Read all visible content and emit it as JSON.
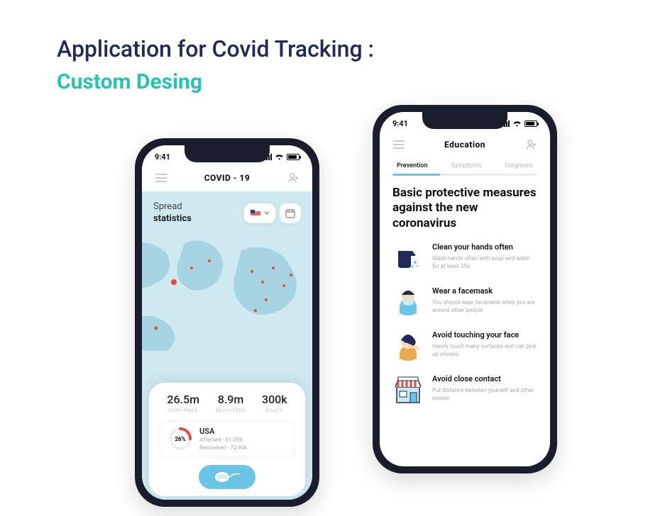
{
  "heading": {
    "title": "Application for Covid Tracking :",
    "subtitle": "Custom Desing"
  },
  "statusbar": {
    "time": "9:41"
  },
  "phoneLeft": {
    "appbar": {
      "title": "COVID - 19"
    },
    "spread": {
      "label1": "Spread",
      "label2": "statistics"
    },
    "stats": [
      {
        "value": "26.5m",
        "label": "CONFIRMED"
      },
      {
        "value": "8.9m",
        "label": "RECOVERED"
      },
      {
        "value": "300k",
        "label": "DEATH"
      }
    ],
    "country": {
      "percent": "26%",
      "name": "USA",
      "affected": "Affected - 81.05k",
      "recovered": "Recovered - 72,44k"
    }
  },
  "phoneRight": {
    "appbar": {
      "title": "Education"
    },
    "tabs": [
      "Prevention",
      "Symptoms",
      "Diagnosis"
    ],
    "progressPercent": "33%",
    "title": "Basic protective measures against the new coronavirus",
    "items": [
      {
        "title": "Clean your hands often",
        "desc": "Wash hands often with soap and water for at least 20s"
      },
      {
        "title": "Wear a facemask",
        "desc": "You should wear facemask when you are around other people."
      },
      {
        "title": "Avoid touching your face",
        "desc": "Hands touch many surfaces and can pick up viruses."
      },
      {
        "title": "Avoid close contact",
        "desc": "Put distance between yourself and other people."
      }
    ]
  }
}
